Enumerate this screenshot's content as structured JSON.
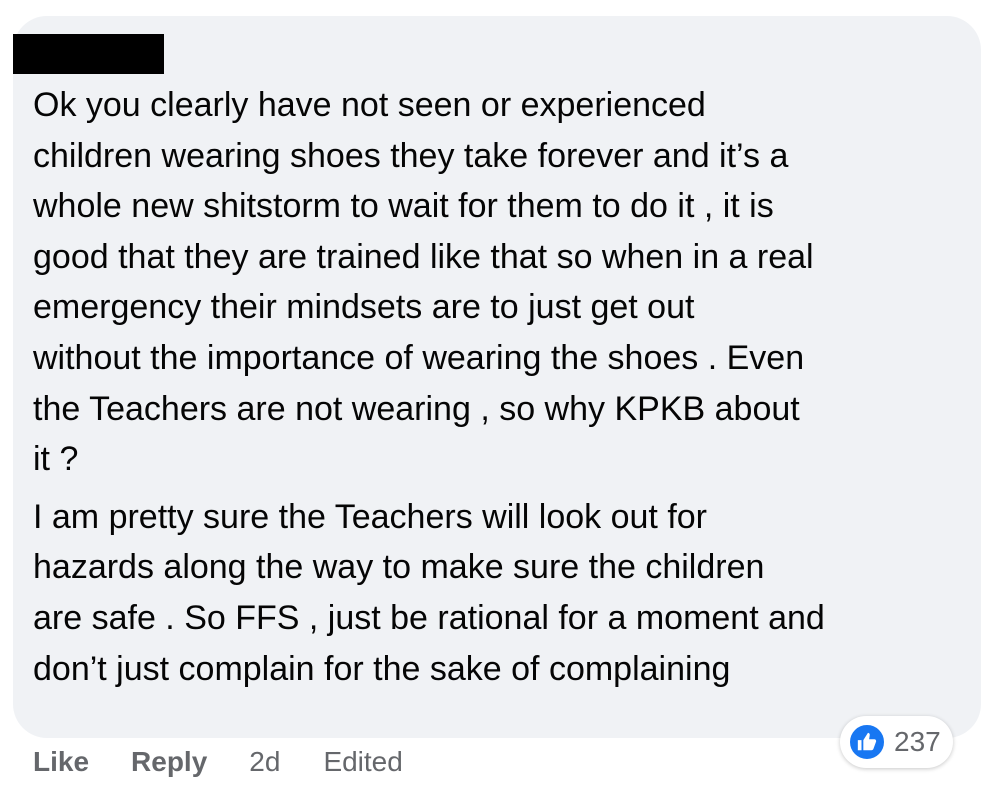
{
  "comment": {
    "paragraphs": [
      "Ok you clearly have not seen or experienced\nchildren wearing shoes they take forever and it’s a\nwhole new shitstorm to wait for them to do it , it is\ngood that they are trained like that so when in a real\nemergency their mindsets are to just get out\nwithout the importance of wearing the shoes . Even\nthe Teachers are not wearing , so why KPKB about\nit ?",
      "I am pretty sure the Teachers will look out for\nhazards along the way to make sure the children\nare safe . So FFS , just be rational for a moment and\ndon’t just complain for the sake of complaining"
    ]
  },
  "actions": {
    "like_label": "Like",
    "reply_label": "Reply",
    "time": "2d",
    "edited_label": "Edited"
  },
  "reactions": {
    "icon": "thumbs-up-icon",
    "count": "237",
    "color": "#1877f2"
  }
}
